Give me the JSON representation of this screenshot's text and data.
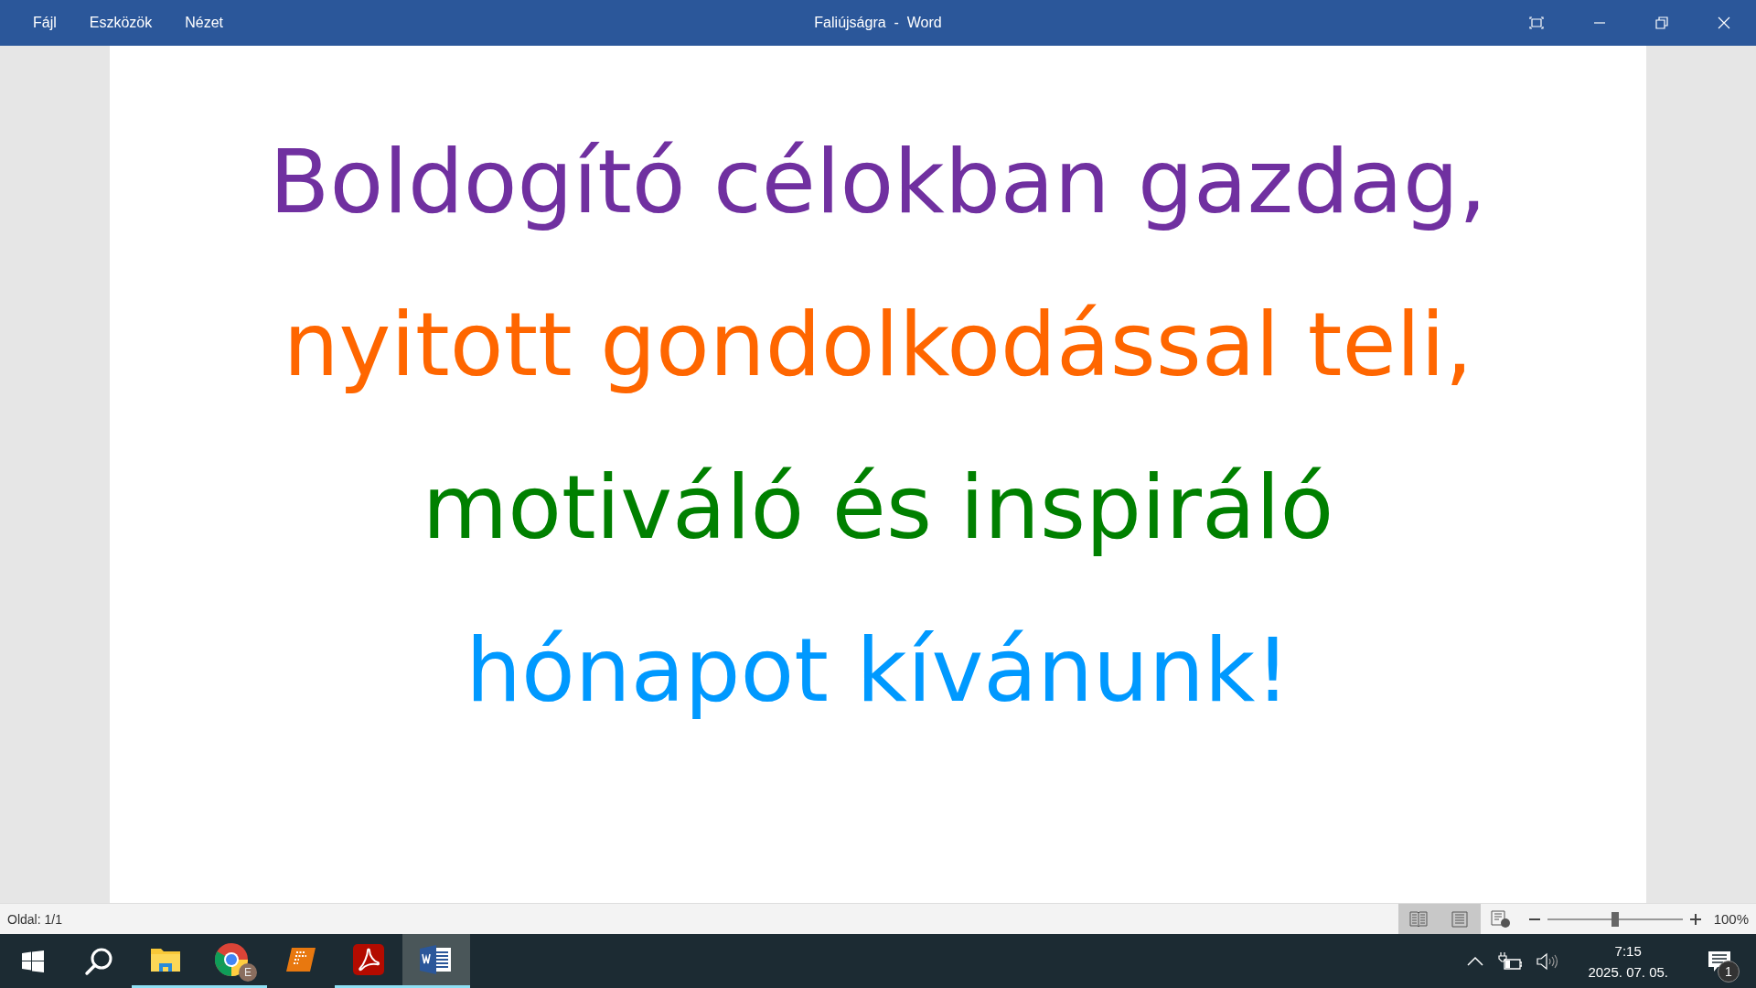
{
  "window": {
    "title": "Faliújságra  -  Word"
  },
  "menu": [
    "Fájl",
    "Eszközök",
    "Nézet"
  ],
  "document": {
    "lines": [
      {
        "text": "Boldogító célokban gazdag,",
        "color": "#7030a0"
      },
      {
        "text": "nyitott gondolkodással teli,",
        "color": "#ff6600"
      },
      {
        "text": "motiváló és inspiráló",
        "color": "#008000"
      },
      {
        "text": "hónapot kívánunk!",
        "color": "#0099ff"
      }
    ]
  },
  "status_bar": {
    "page": "Oldal: 1/1",
    "views": [
      {
        "kind": "read",
        "selected": true
      },
      {
        "kind": "print",
        "selected": true
      },
      {
        "kind": "web",
        "selected": false
      }
    ],
    "zoom": {
      "level": 0.5,
      "reading": "100%"
    }
  },
  "taskbar": {
    "apps": [
      {
        "kind": "explorer",
        "running": true,
        "selected": false
      },
      {
        "kind": "chrome",
        "badge": "E",
        "running": true,
        "selected": false
      },
      {
        "kind": "orange",
        "running": false,
        "selected": false
      },
      {
        "kind": "acrobat",
        "running": true,
        "selected": false
      },
      {
        "kind": "word",
        "running": true,
        "selected": true
      }
    ],
    "time": "7:15",
    "date": "2025. 07. 05.",
    "notifications": "1"
  }
}
